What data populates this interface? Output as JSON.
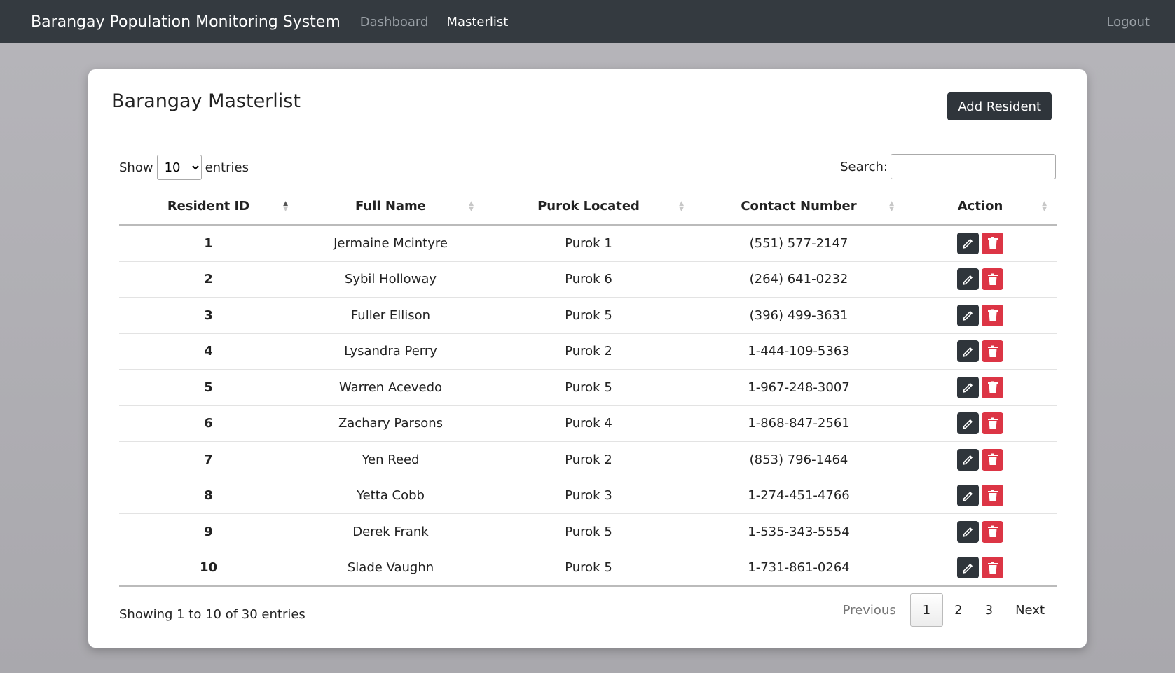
{
  "navbar": {
    "brand": "Barangay Population Monitoring System",
    "links": [
      "Dashboard",
      "Masterlist"
    ],
    "logout": "Logout"
  },
  "card": {
    "title": "Barangay Masterlist",
    "add_button": "Add Resident"
  },
  "length": {
    "show": "Show",
    "value": "10",
    "entries": "entries"
  },
  "search": {
    "label": "Search:",
    "value": ""
  },
  "table": {
    "headers": [
      "Resident ID",
      "Full Name",
      "Purok Located",
      "Contact Number",
      "Action"
    ],
    "rows": [
      [
        "1",
        "Jermaine Mcintyre",
        "Purok 1",
        "(551) 577-2147"
      ],
      [
        "2",
        "Sybil Holloway",
        "Purok 6",
        "(264) 641-0232"
      ],
      [
        "3",
        "Fuller Ellison",
        "Purok 5",
        "(396) 499-3631"
      ],
      [
        "4",
        "Lysandra Perry",
        "Purok 2",
        "1-444-109-5363"
      ],
      [
        "5",
        "Warren Acevedo",
        "Purok 5",
        "1-967-248-3007"
      ],
      [
        "6",
        "Zachary Parsons",
        "Purok 4",
        "1-868-847-2561"
      ],
      [
        "7",
        "Yen Reed",
        "Purok 2",
        "(853) 796-1464"
      ],
      [
        "8",
        "Yetta Cobb",
        "Purok 3",
        "1-274-451-4766"
      ],
      [
        "9",
        "Derek Frank",
        "Purok 5",
        "1-535-343-5554"
      ],
      [
        "10",
        "Slade Vaughn",
        "Purok 5",
        "1-731-861-0264"
      ]
    ]
  },
  "footer": {
    "info": "Showing 1 to 10 of 30 entries",
    "previous": "Previous",
    "pages": [
      "1",
      "2",
      "3"
    ],
    "next": "Next"
  }
}
